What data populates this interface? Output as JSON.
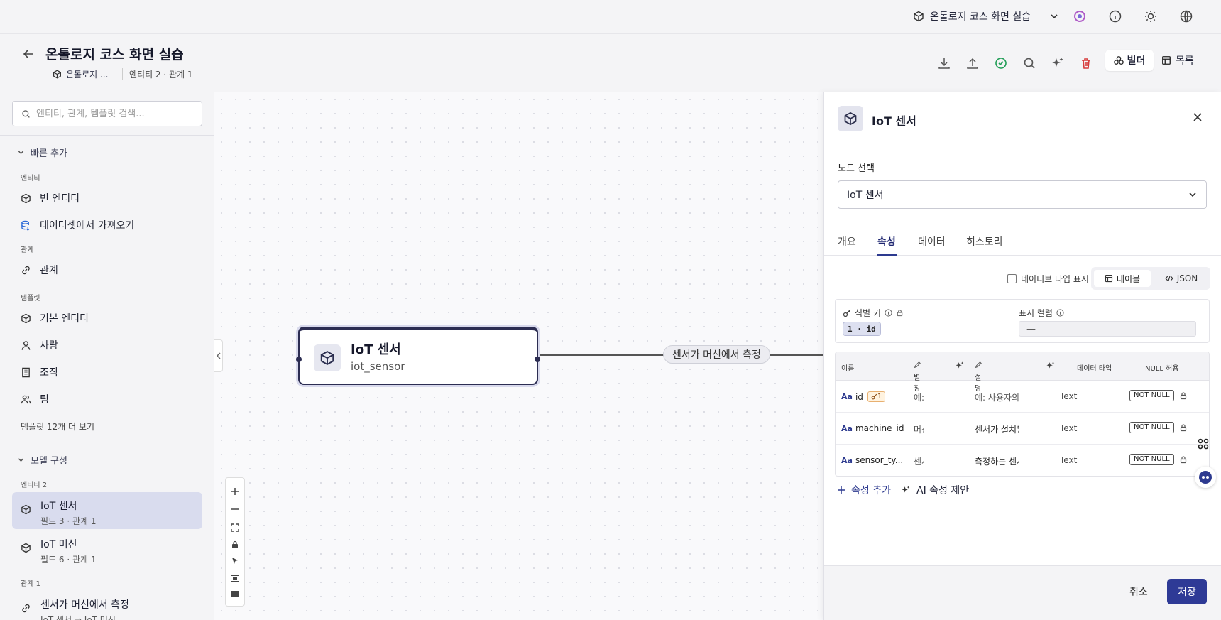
{
  "topbar": {
    "project_name": "온톨로지 코스 화면 실습",
    "icons": [
      "cube-icon",
      "chevron-down-icon",
      "ai-assistant-icon",
      "info-icon",
      "sun-icon",
      "globe-icon"
    ]
  },
  "header": {
    "title": "온톨로지 코스 화면 실습",
    "breadcrumb": "온톨로지 ...",
    "meta": "엔티티 2 · 관계 1",
    "builder_label": "빌더",
    "list_label": "목록"
  },
  "sidebar": {
    "search_placeholder": "엔티티, 관계, 템플릿 검색...",
    "quick_add": {
      "title": "빠른 추가",
      "entity_group": "엔티티",
      "entity_items": [
        "빈 엔티티",
        "데이터셋에서 가져오기"
      ],
      "relation_group": "관계",
      "relation_items": [
        "관계"
      ],
      "template_group": "템플릿",
      "template_items": [
        "기본 엔티티",
        "사람",
        "조직",
        "팀"
      ],
      "more": "템플릿 12개 더 보기"
    },
    "model": {
      "title": "모델 구성",
      "entity_group": "엔티티 2",
      "entities": [
        {
          "name": "IoT 센서",
          "sub": "필드 3 · 관계 1"
        },
        {
          "name": "IoT 머신",
          "sub": "필드 6 · 관계 1"
        }
      ],
      "relation_group": "관계 1",
      "relations": [
        {
          "name": "센서가 머신에서 측정",
          "sub": "IoT 센서 → IoT 머신"
        }
      ]
    }
  },
  "canvas": {
    "node": {
      "title": "IoT 센서",
      "subtitle": "iot_sensor"
    },
    "edge_label": "센서가 머신에서 측정"
  },
  "panel": {
    "title": "IoT 센서",
    "node_select_label": "노드 선택",
    "node_select_value": "IoT 센서",
    "tabs": [
      "개요",
      "속성",
      "데이터",
      "히스토리"
    ],
    "active_tab": "속성",
    "native_type_label": "네이티브 타입 표시",
    "view_table": "테이블",
    "view_json": "JSON",
    "identifier_key_label": "식별 키",
    "identifier_key_value": "1 · id",
    "display_column_label": "표시 컬럼",
    "display_column_value": "—",
    "table_headers": [
      "이름",
      "별칭",
      "설명",
      "데이터 타입",
      "NULL 허용"
    ],
    "rows": [
      {
        "name": "id",
        "pk": "1",
        "alias": "예:",
        "desc": "예: 사용자의",
        "type": "Text",
        "null": "NOT NULL"
      },
      {
        "name": "machine_id",
        "pk": "",
        "alias": "머신",
        "desc": "센서가 설치된",
        "type": "Text",
        "null": "NOT NULL"
      },
      {
        "name": "sensor_ty...",
        "pk": "",
        "alias": "센서",
        "desc": "측정하는 센서",
        "type": "Text",
        "null": "NOT NULL"
      }
    ],
    "add_attribute": "속성 추가",
    "ai_suggest": "AI 속성 제안",
    "cancel": "취소",
    "save": "저장"
  },
  "colors": {
    "accent": "#2e3a96",
    "node_border": "#2c2d52",
    "selected_bg": "#d9dcee"
  }
}
